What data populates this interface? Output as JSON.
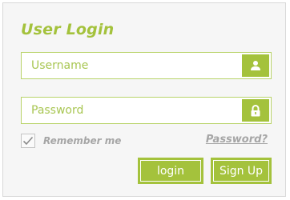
{
  "form": {
    "title": "User Login",
    "username_placeholder": "Username",
    "password_placeholder": "Password",
    "remember_label": "Remember me",
    "remember_checked": true,
    "forgot_link": "Password?",
    "login_label": "login",
    "signup_label": "Sign Up"
  },
  "colors": {
    "accent": "#a4c23c",
    "muted_text": "#a6a6a6",
    "panel_bg": "#f6f6f6"
  },
  "icons": {
    "username": "user-icon",
    "password": "lock-icon",
    "remember": "checkmark-icon"
  }
}
